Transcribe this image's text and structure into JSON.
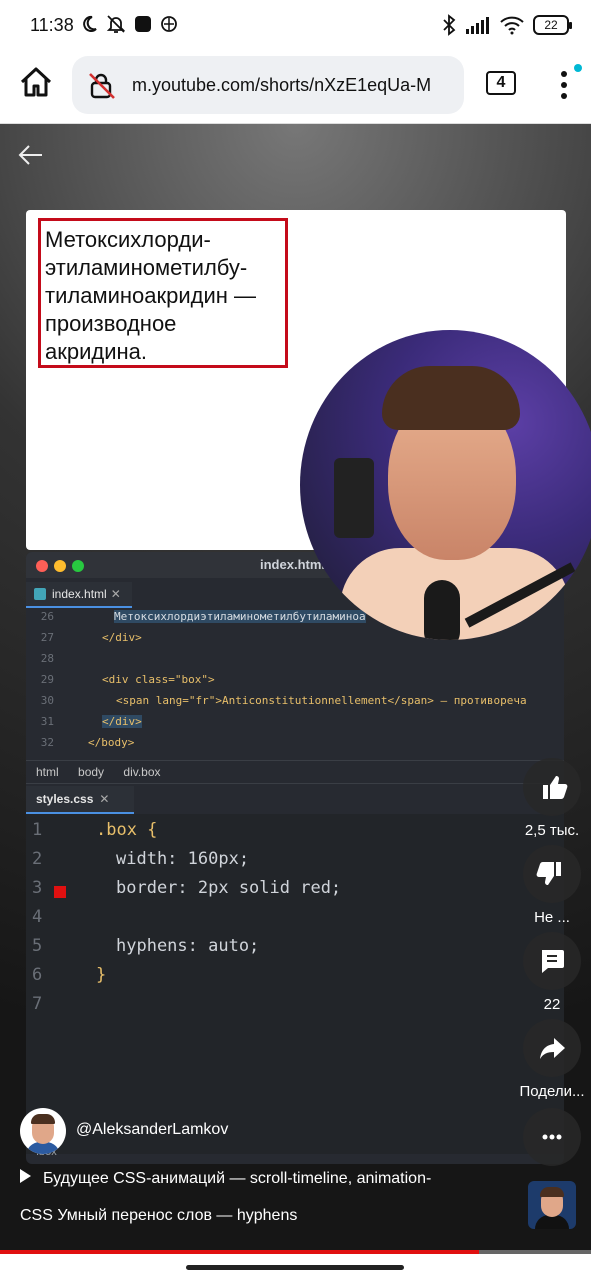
{
  "status_bar": {
    "time": "11:38",
    "battery": "22",
    "left_icons": [
      "moon-icon",
      "bell-off-icon",
      "app-square-icon",
      "vpn-icon"
    ],
    "right_icons": [
      "bluetooth-icon",
      "signal-icon",
      "wifi-icon",
      "battery-icon"
    ]
  },
  "browser": {
    "url": "m.youtube.com/shorts/nXzE1eqUa-M",
    "tab_count": "4",
    "accent_dot_color": "#00b8d4"
  },
  "video": {
    "slide_text": [
      "Метоксихлорди-",
      "этиламинометилбу-",
      "тиламиноакридин —",
      "производное",
      "акридина."
    ],
    "ide": {
      "title": "index.html",
      "html_tab": "index.html",
      "html_lines": [
        {
          "num": "26",
          "text": "Метоксихлордиэтиламинометилбутиламиноа"
        },
        {
          "num": "27",
          "text": "</div>"
        },
        {
          "num": "28",
          "text": ""
        },
        {
          "num": "29",
          "text": "<div class=\"box\">"
        },
        {
          "num": "30",
          "text": "<span lang=\"fr\">Anticonstitutionnellement</span> — противореча"
        },
        {
          "num": "31",
          "text": "</div>"
        },
        {
          "num": "32",
          "text": "</body>"
        }
      ],
      "breadcrumb": [
        "html",
        "body",
        "div.box"
      ],
      "css_tab": "styles.css",
      "css_lines": [
        {
          "num": "1",
          "text": ".box {"
        },
        {
          "num": "2",
          "text": "width: 160px;"
        },
        {
          "num": "3",
          "text": "border: 2px solid red;"
        },
        {
          "num": "4",
          "text": ""
        },
        {
          "num": "5",
          "text": "hyphens: auto;"
        },
        {
          "num": "6",
          "text": "}"
        },
        {
          "num": "7",
          "text": ""
        }
      ],
      "footer": ".box"
    },
    "actions": {
      "like_count": "2,5 тыс.",
      "dislike_label": "Не ...",
      "comment_count": "22",
      "share_label": "Подели..."
    },
    "channel": "@AleksanderLamkov",
    "playlist": "Будущее CSS-анимаций — scroll-timeline, animation-",
    "title": "CSS Умный перенос слов — hyphens",
    "progress": 0.81,
    "progress_color": "#e01010"
  }
}
